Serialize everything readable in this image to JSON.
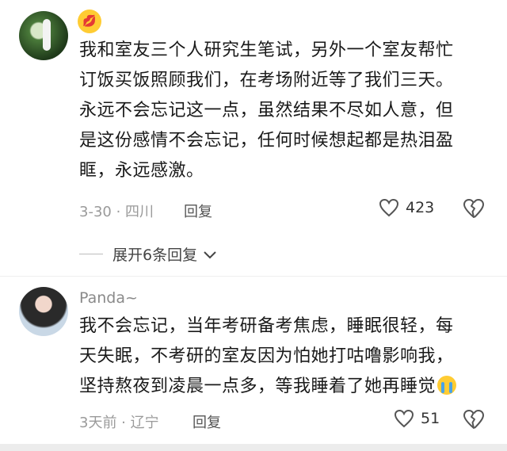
{
  "comments": [
    {
      "username": "",
      "lines": [
        "我和室友三个人研究生笔试，另外一个室友帮忙",
        "订饭买饭照顾我们，在考场附近等了我们三天。",
        "永远不会忘记这一点，虽然结果不尽如人意，但",
        "是这份感情不会忘记，任何时候想起都是热泪盈",
        "眶，永远感激。"
      ],
      "meta": "3-30 · 四川",
      "reply_label": "回复",
      "likes": "423",
      "expand_label": "展开6条回复"
    },
    {
      "username": "Panda~",
      "lines": [
        "我不会忘记，当年考研备考焦虑，睡眠很轻，每",
        "天失眠，不考研的室友因为怕她打咕噜影响我，",
        "坚持熬夜到凌晨一点多，等我睡着了她再睡觉"
      ],
      "meta": "3天前 · 辽宁",
      "reply_label": "回复",
      "likes": "51"
    }
  ],
  "icons": {
    "kiss_emoji": "kiss-emoji",
    "cry_emoji": "crying-emoji",
    "like": "heart-icon",
    "dislike": "broken-heart-icon",
    "expand": "chevron-down-icon"
  }
}
